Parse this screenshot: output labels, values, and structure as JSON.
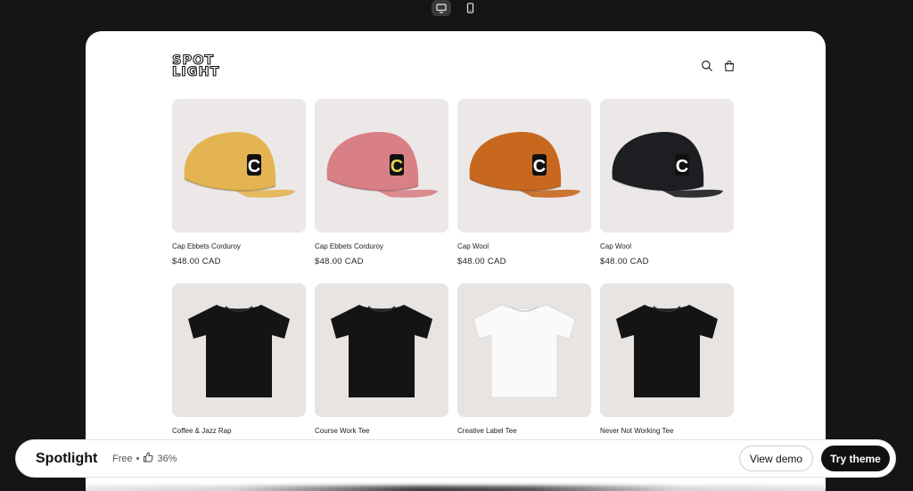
{
  "device_toggle": {
    "desktop_icon": "monitor-icon",
    "mobile_icon": "phone-icon",
    "active": "desktop"
  },
  "store": {
    "logo_line1": "SPOT",
    "logo_line2": "LIGHT",
    "search_icon": "search-icon",
    "cart_icon": "cart-icon"
  },
  "products": [
    {
      "title": "Cap Ebbets Corduroy",
      "price": "$48.00 CAD",
      "kind": "cap",
      "color": "#e3b451"
    },
    {
      "title": "Cap Ebbets Corduroy",
      "price": "$48.00 CAD",
      "kind": "cap",
      "color": "#d97f86"
    },
    {
      "title": "Cap Wool",
      "price": "$48.00 CAD",
      "kind": "cap",
      "color": "#c8681f"
    },
    {
      "title": "Cap Wool",
      "price": "$48.00 CAD",
      "kind": "cap",
      "color": "#1d1e22"
    },
    {
      "title": "Coffee & Jazz Rap",
      "price": "",
      "kind": "tee",
      "color": "#141414"
    },
    {
      "title": "Course Work Tee",
      "price": "",
      "kind": "tee",
      "color": "#141414"
    },
    {
      "title": "Creative Label Tee",
      "price": "",
      "kind": "tee",
      "color": "#fafafa"
    },
    {
      "title": "Never Not Working Tee",
      "price": "",
      "kind": "tee",
      "color": "#141414"
    }
  ],
  "bottom_bar": {
    "theme_name": "Spotlight",
    "price": "Free",
    "separator": "•",
    "rating_icon": "thumbs-up-icon",
    "rating": "36%",
    "view_demo": "View demo",
    "try_theme": "Try theme"
  }
}
